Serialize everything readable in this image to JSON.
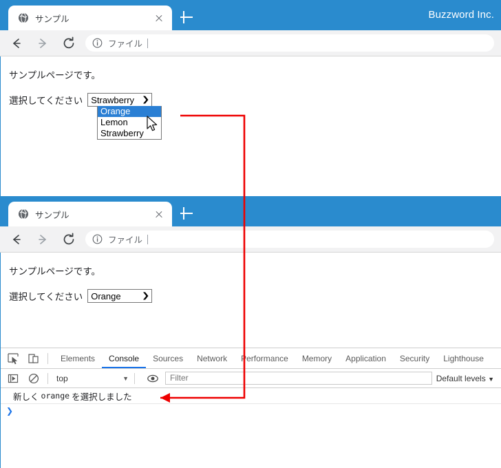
{
  "windows": [
    {
      "id": "window-top",
      "brand": "Buzzword Inc.",
      "tab": {
        "title": "サンプル",
        "favicon": "globe-icon",
        "close": "close-icon"
      },
      "newtab_label": "+",
      "omnibox": {
        "info_icon": "info-circle-icon",
        "text": "ファイル"
      },
      "nav": {
        "back": "back-arrow-icon",
        "forward": "forward-arrow-icon",
        "reload": "reload-icon"
      },
      "page": {
        "heading": "サンプルページです。",
        "label": "選択してください",
        "select": {
          "value": "Strawberry",
          "arrow": "chevron-down-icon",
          "expanded": true,
          "options": [
            "Orange",
            "Lemon",
            "Strawberry"
          ],
          "highlighted": "Orange"
        },
        "cursor": "mouse-pointer"
      }
    },
    {
      "id": "window-bottom",
      "brand": "",
      "tab": {
        "title": "サンプル",
        "favicon": "globe-icon",
        "close": "close-icon"
      },
      "newtab_label": "+",
      "omnibox": {
        "info_icon": "info-circle-icon",
        "text": "ファイル"
      },
      "nav": {
        "back": "back-arrow-icon",
        "forward": "forward-arrow-icon",
        "reload": "reload-icon"
      },
      "page": {
        "heading": "サンプルページです。",
        "label": "選択してください",
        "select": {
          "value": "Orange",
          "arrow": "chevron-down-icon",
          "expanded": false,
          "options": [
            "Orange",
            "Lemon",
            "Strawberry"
          ]
        }
      }
    }
  ],
  "devtools": {
    "inspect_icon": "inspect-element-icon",
    "device_icon": "device-toolbar-icon",
    "tabs": [
      {
        "label": "Elements",
        "active": false
      },
      {
        "label": "Console",
        "active": true
      },
      {
        "label": "Sources",
        "active": false
      },
      {
        "label": "Network",
        "active": false
      },
      {
        "label": "Performance",
        "active": false
      },
      {
        "label": "Memory",
        "active": false
      },
      {
        "label": "Application",
        "active": false
      },
      {
        "label": "Security",
        "active": false
      },
      {
        "label": "Lighthouse",
        "active": false
      }
    ],
    "console_toolbar": {
      "execute_icon": "execute-step-icon",
      "clear_icon": "clear-console-icon",
      "context": "top",
      "context_arrow": "▼",
      "eye_icon": "live-expression-icon",
      "filter_placeholder": "Filter",
      "filter_value": "",
      "levels_label": "Default levels",
      "levels_arrow": "▼"
    },
    "messages": [
      {
        "prefix": "新しく",
        "code": "orange",
        "suffix": "を選択しました"
      }
    ],
    "prompt": "❯"
  },
  "annotation": {
    "color": "#ee0000",
    "description": "red-callout-line-from-dropdown-to-console"
  }
}
